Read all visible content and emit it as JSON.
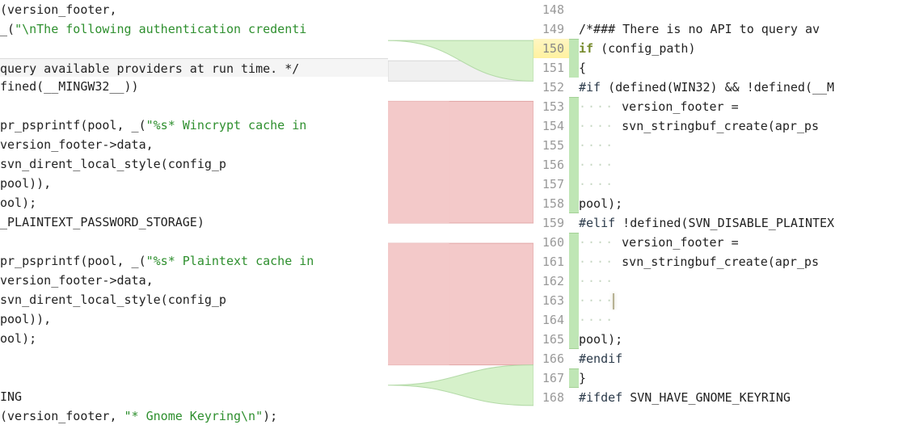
{
  "left": {
    "lines": [
      {
        "bg": "none",
        "html": "(version_footer,"
      },
      {
        "bg": "none",
        "html": "  _(<span class='str'>\"\\nThe following authentication credenti</span>"
      },
      {
        "bg": "none",
        "html": ""
      },
      {
        "bg": "delline top",
        "html": " query available providers at run time. */"
      },
      {
        "bg": "none",
        "html": "fined(__MINGW32__))"
      },
      {
        "bg": "none",
        "html": ""
      },
      {
        "bg": "none",
        "html": "pr_psprintf(pool, _(<span class='str'>\"%s* Wincrypt cache in </span>"
      },
      {
        "bg": "none",
        "html": "               version_footer-&gt;data,"
      },
      {
        "bg": "none",
        "html": "               svn_dirent_local_style(config_p"
      },
      {
        "bg": "none",
        "html": "                                      pool)),"
      },
      {
        "bg": "none",
        "html": "ool);"
      },
      {
        "bg": "none",
        "html": "_PLAINTEXT_PASSWORD_STORAGE)"
      },
      {
        "bg": "none",
        "html": ""
      },
      {
        "bg": "none",
        "html": "pr_psprintf(pool, _(<span class='str'>\"%s* Plaintext cache in</span>"
      },
      {
        "bg": "none",
        "html": "               version_footer-&gt;data,"
      },
      {
        "bg": "none",
        "html": "               svn_dirent_local_style(config_p"
      },
      {
        "bg": "none",
        "html": "                                      pool)),"
      },
      {
        "bg": "none",
        "html": "ool);"
      },
      {
        "bg": "none",
        "html": ""
      },
      {
        "bg": "none",
        "html": ""
      },
      {
        "bg": "none",
        "html": "ING"
      },
      {
        "bg": "none",
        "html": "(version_footer, <span class='str'>\"* Gnome Keyring\\n\"</span>);"
      }
    ]
  },
  "gutter": {
    "start": 148,
    "highlight": 150
  },
  "right": {
    "lines": [
      {
        "mk": "",
        "bg": "none",
        "html": ""
      },
      {
        "mk": "",
        "bg": "none",
        "html": "  /*### There is no API to query av"
      },
      {
        "mk": "green-t",
        "bg": "addline top",
        "html": "  <span class='kw'>if</span> (config_path)"
      },
      {
        "mk": "green",
        "bg": "addline bot",
        "html": "    {"
      },
      {
        "mk": "",
        "bg": "none",
        "html": "<span class='pp'>#if</span> (defined(WIN32) &amp;&amp; !defined(__M"
      },
      {
        "mk": "green-t",
        "bg": "addline top",
        "html": "<span class='dots'>····</span>  version_footer ="
      },
      {
        "mk": "green",
        "bg": "addline",
        "html": "<span class='dots'>····</span>    svn_stringbuf_create(apr_ps"
      },
      {
        "mk": "green",
        "bg": "addline",
        "html": "<span class='dots'>····</span>"
      },
      {
        "mk": "green",
        "bg": "addline",
        "html": "<span class='dots'>····</span>"
      },
      {
        "mk": "green",
        "bg": "addline",
        "html": "<span class='dots'>····</span>"
      },
      {
        "mk": "green-b",
        "bg": "addline bot",
        "html": "                              pool);"
      },
      {
        "mk": "",
        "bg": "none",
        "html": "<span class='pp'>#elif</span> !defined(SVN_DISABLE_PLAINTEX"
      },
      {
        "mk": "green-t",
        "bg": "addline top",
        "html": "<span class='dots'>····</span>  version_footer ="
      },
      {
        "mk": "green",
        "bg": "addline",
        "html": "<span class='dots'>····</span>    svn_stringbuf_create(apr_ps"
      },
      {
        "mk": "green",
        "bg": "addline",
        "html": "<span class='dots'>····</span>"
      },
      {
        "mk": "green",
        "bg": "addline",
        "html": "<span class='dots'>····</span><span class='cursor'></span>"
      },
      {
        "mk": "green",
        "bg": "addline",
        "html": "<span class='dots'>····</span>"
      },
      {
        "mk": "green-b",
        "bg": "addline bot",
        "html": "                              pool);"
      },
      {
        "mk": "",
        "bg": "none",
        "html": "<span class='pp'>#endif</span>"
      },
      {
        "mk": "green-s",
        "bg": "addline top bot",
        "html": "      }"
      },
      {
        "mk": "",
        "bg": "none",
        "html": "<span class='pp'>#ifdef</span> SVN_HAVE_GNOME_KEYRING"
      }
    ]
  },
  "gap": {
    "deleted_blocks": [
      {
        "top_row": 5,
        "bot_row": 10
      },
      {
        "top_row": 12,
        "bot_row": 17
      }
    ],
    "grey_band": {
      "row": 3
    },
    "curves": [
      {
        "l0": 0,
        "l1": 2,
        "r0": 0,
        "r1": 2,
        "fill": "none"
      },
      {
        "l0": 2,
        "l1": 2,
        "r0": 2,
        "r1": 4,
        "fill": "#d6f1ca"
      },
      {
        "l0": 5,
        "l1": 11,
        "r0": 5,
        "r1": 11,
        "fill": "#f3c9c9",
        "left_red": true
      },
      {
        "l0": 12,
        "l1": 18,
        "r0": 12,
        "r1": 18,
        "fill": "#f3c9c9",
        "left_red": true
      },
      {
        "l0": 19,
        "l1": 19,
        "r0": 18,
        "r1": 20,
        "fill": "#d6f1ca"
      }
    ]
  }
}
